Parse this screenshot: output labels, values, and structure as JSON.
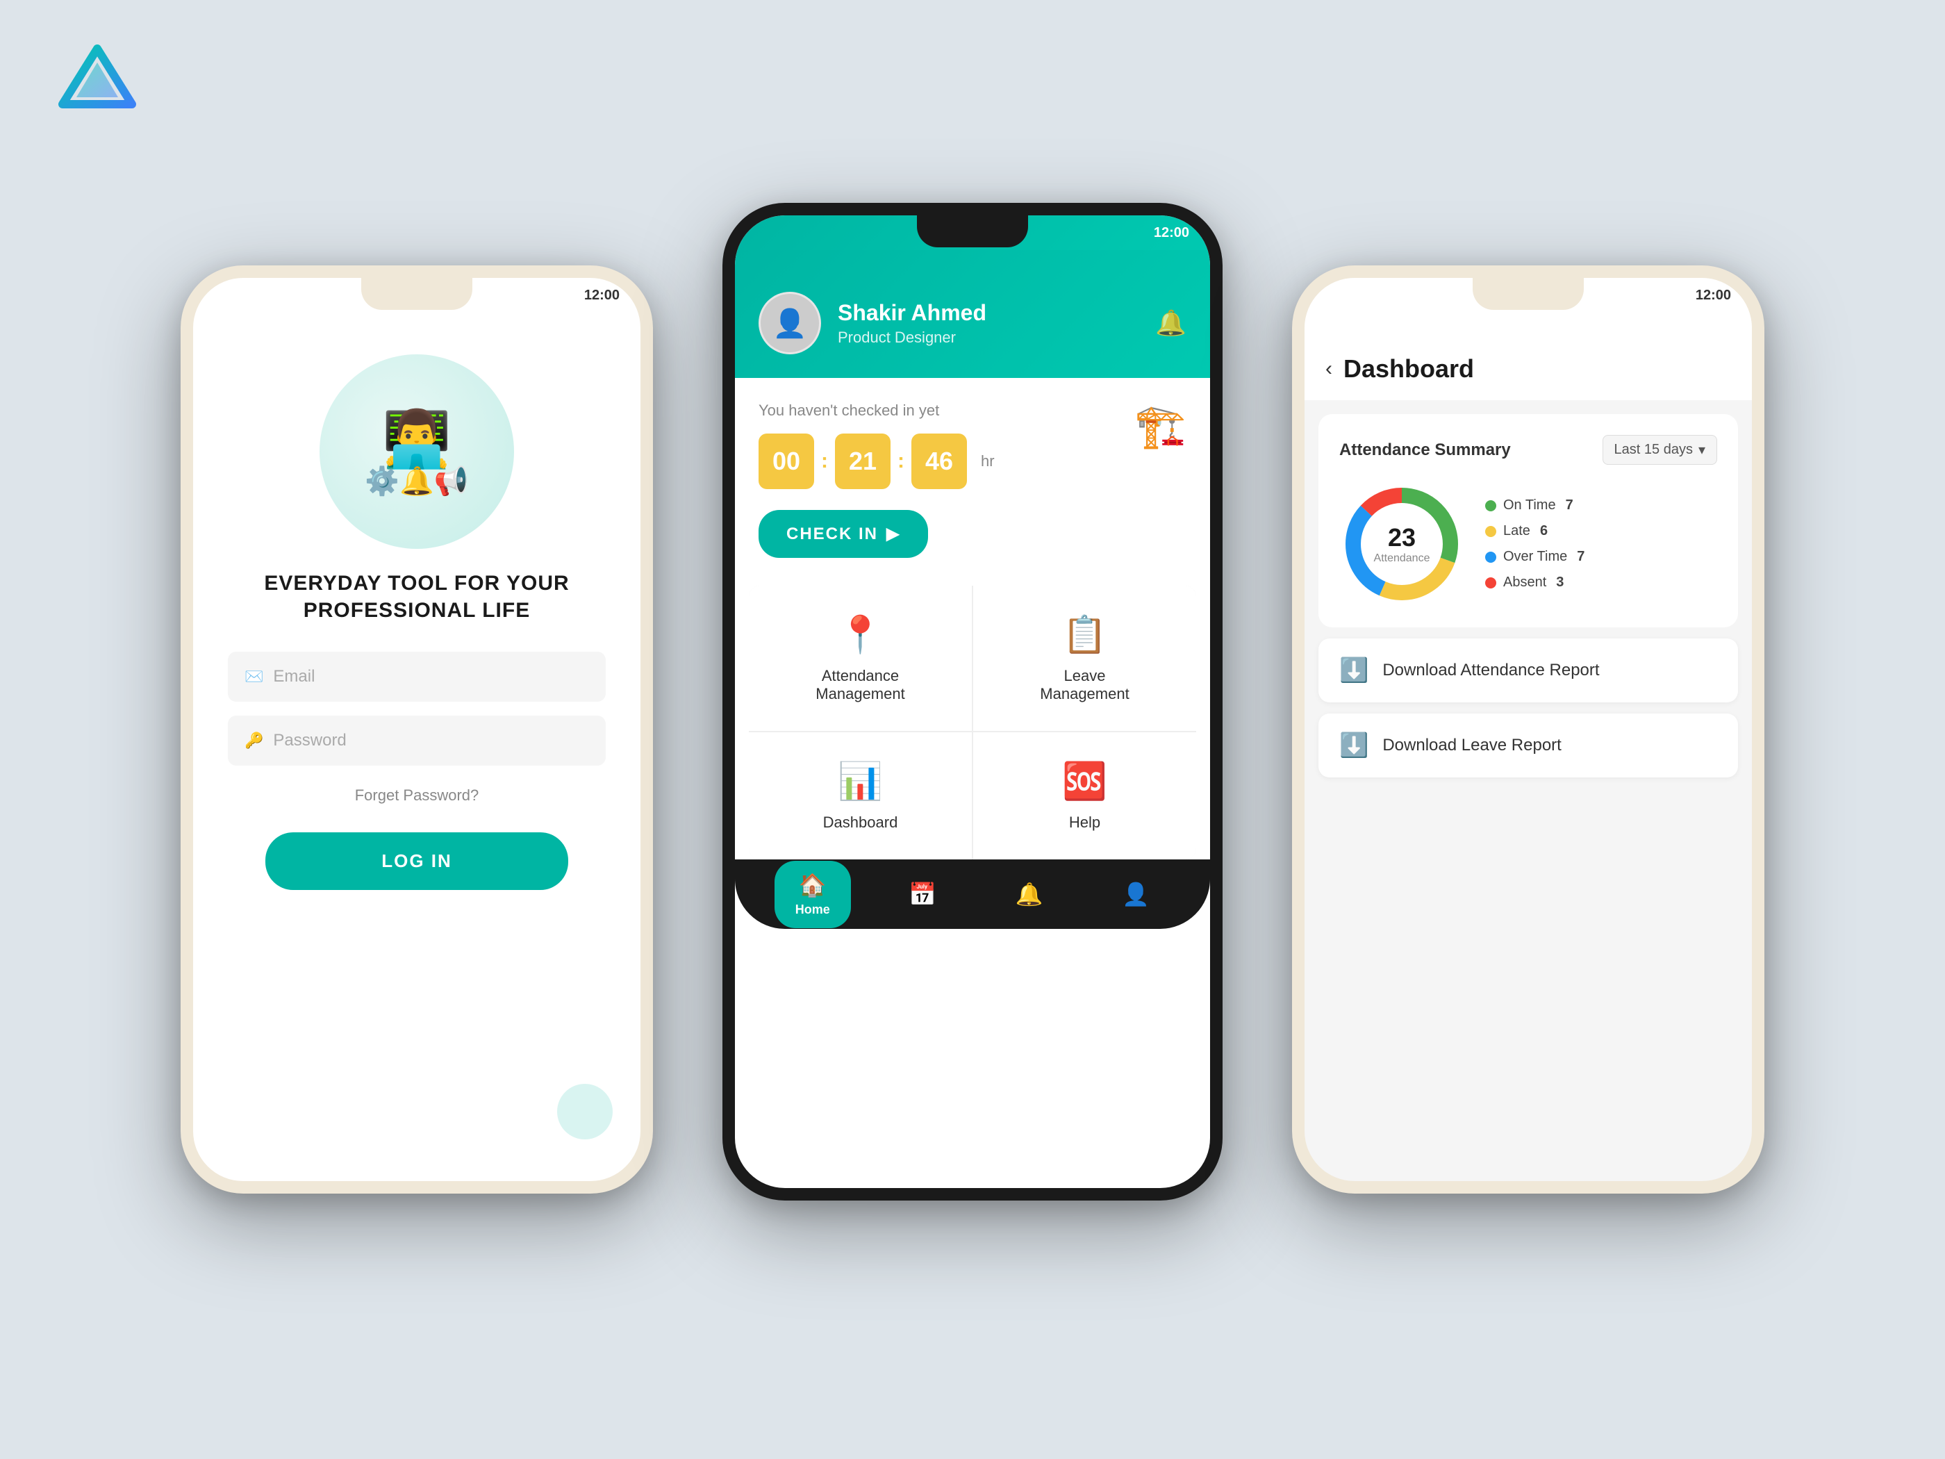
{
  "logo": {
    "alt": "App Logo"
  },
  "phone1": {
    "tagline": "EVERYDAY TOOL FOR YOUR PROFESSIONAL LIFE",
    "email_placeholder": "Email",
    "password_placeholder": "Password",
    "forget_password": "Forget Password?",
    "login_button": "LOG IN"
  },
  "phone2": {
    "user_name": "Shakir Ahmed",
    "user_role": "Product Designer",
    "checkin_prompt": "You haven't checked in yet",
    "time_hh": "00",
    "time_mm": "21",
    "time_ss": "46",
    "time_unit": "hr",
    "checkin_button": "CHECK IN",
    "menu_items": [
      {
        "label": "Attendance Management",
        "icon": "📍"
      },
      {
        "label": "Leave Management",
        "icon": "📋"
      },
      {
        "label": "Dashboard",
        "icon": "📊"
      },
      {
        "label": "Help",
        "icon": "🆘"
      }
    ],
    "nav_items": [
      {
        "label": "Home",
        "icon": "🏠",
        "active": true
      },
      {
        "label": "Calendar",
        "icon": "📅",
        "active": false
      },
      {
        "label": "Bell",
        "icon": "🔔",
        "active": false
      },
      {
        "label": "Profile",
        "icon": "👤",
        "active": false
      }
    ]
  },
  "phone3": {
    "back_label": "‹",
    "title": "Dashboard",
    "summary_title": "Attendance Summary",
    "period_label": "Last 15 days",
    "donut_number": "23",
    "donut_sub": "Attendance",
    "legend": [
      {
        "label": "On Time",
        "value": "7",
        "color": "#4caf50"
      },
      {
        "label": "Late",
        "value": "6",
        "color": "#f5c842"
      },
      {
        "label": "Over Time",
        "value": "7",
        "color": "#2196f3"
      },
      {
        "label": "Absent",
        "value": "3",
        "color": "#f44336"
      }
    ],
    "report_buttons": [
      {
        "label": "Download Attendance Report"
      },
      {
        "label": "Download Leave Report"
      }
    ]
  }
}
